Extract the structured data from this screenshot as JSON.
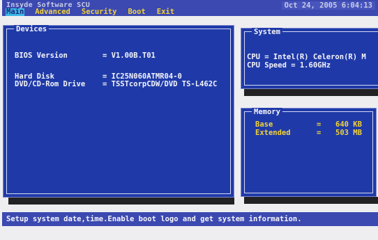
{
  "header": {
    "vendor": "Insyde Software SCU",
    "datetime": "Oct 24, 2005   6:04:13"
  },
  "menu": {
    "items": [
      {
        "label": "Main",
        "active": true
      },
      {
        "label": "Advanced",
        "active": false
      },
      {
        "label": "Security",
        "active": false
      },
      {
        "label": "Boot",
        "active": false
      },
      {
        "label": "Exit",
        "active": false
      }
    ]
  },
  "devices": {
    "title": "Devices",
    "bios_label": "BIOS Version",
    "bios_value": "= V1.00B.T01",
    "hdd_label": "Hard Disk",
    "hdd_value": "= IC25N060ATMR04-0",
    "dvd_label": "DVD/CD-Rom Drive",
    "dvd_value": "= TSSTcorpCDW/DVD TS-L462C"
  },
  "system": {
    "title": "System",
    "cpu": "CPU = Intel(R) Celeron(R) M",
    "cpu_speed": "CPU Speed = 1.60GHz"
  },
  "memory": {
    "title": "Memory",
    "base_label": "Base",
    "base_eq": "=",
    "base_value": "640 KB",
    "extended_label": "Extended",
    "extended_eq": "=",
    "extended_value": "503 MB"
  },
  "status": {
    "text": "Setup system date,time.Enable boot logo and get system information."
  }
}
